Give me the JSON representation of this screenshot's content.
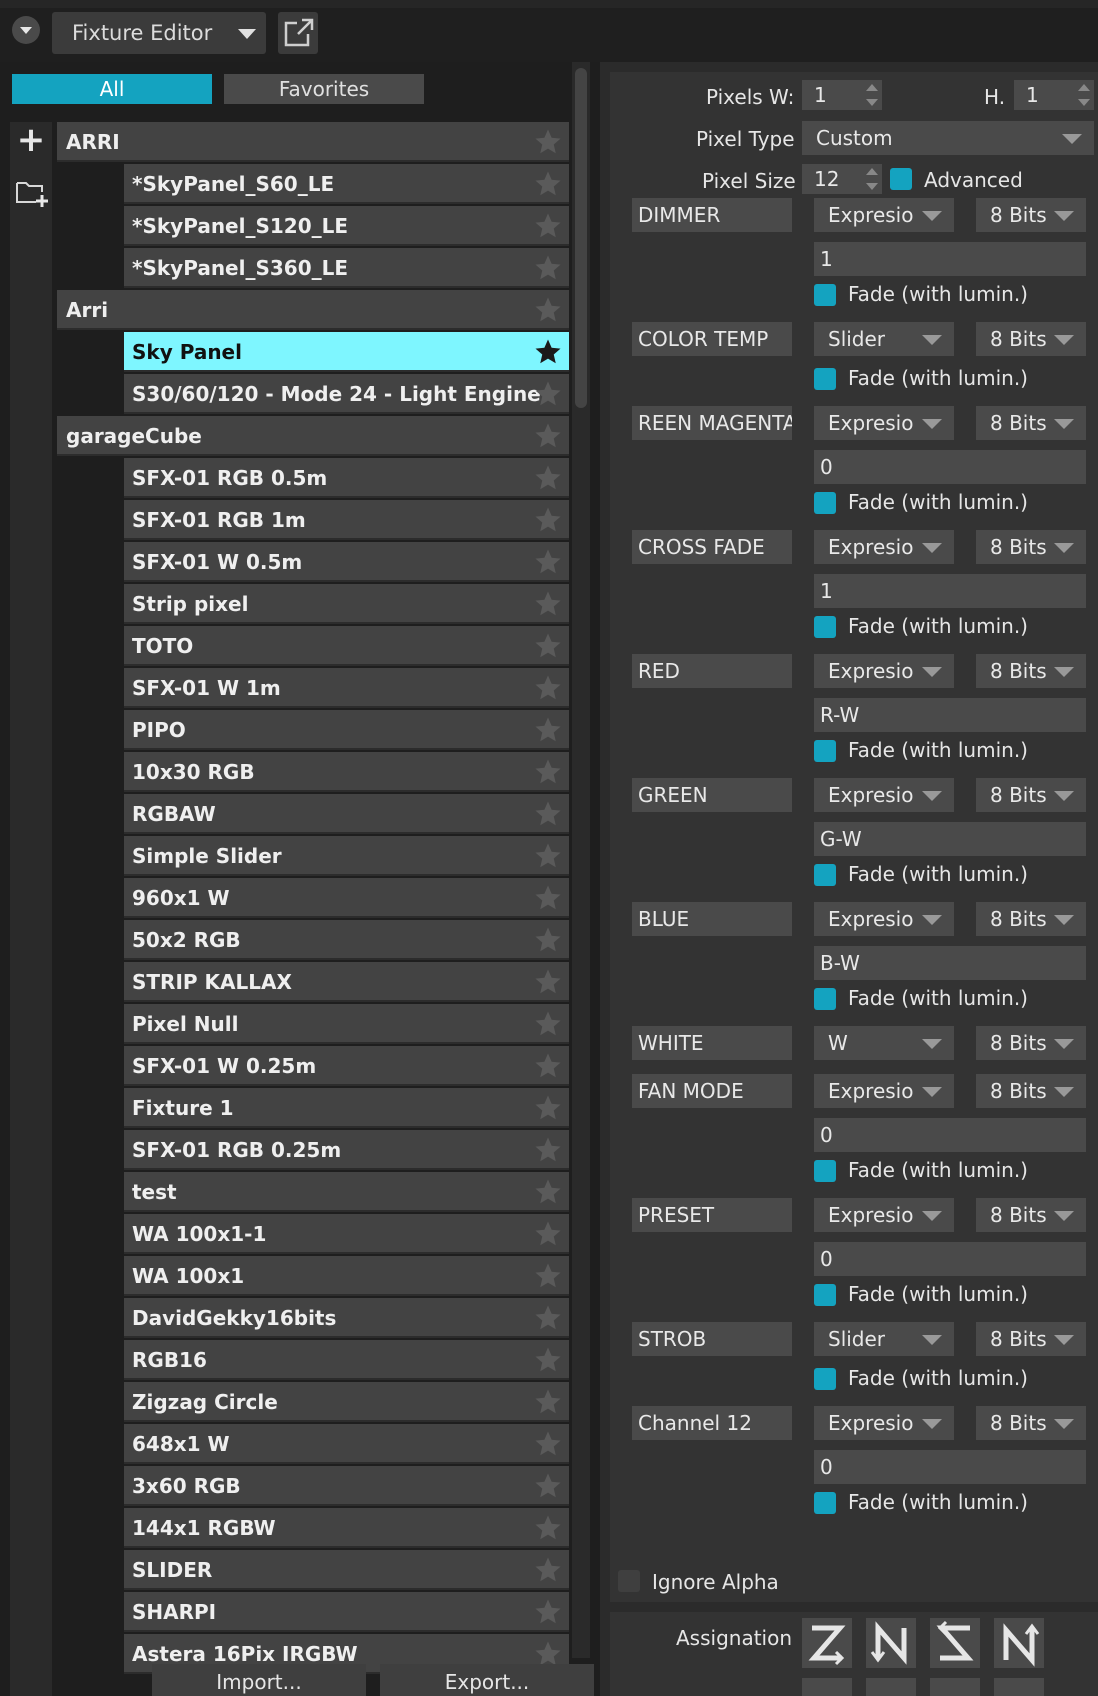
{
  "header": {
    "title": "Fixture Editor"
  },
  "tabs": {
    "all": "All",
    "favorites": "Favorites"
  },
  "fixtures": [
    {
      "label": "ARRI",
      "kind": "group",
      "favorite": false
    },
    {
      "label": "*SkyPanel_S60_LE",
      "kind": "item",
      "favorite": false
    },
    {
      "label": "*SkyPanel_S120_LE",
      "kind": "item",
      "favorite": false
    },
    {
      "label": "*SkyPanel_S360_LE",
      "kind": "item",
      "favorite": false
    },
    {
      "label": "Arri",
      "kind": "group",
      "favorite": false
    },
    {
      "label": "Sky Panel",
      "kind": "item",
      "selected": true,
      "favorite": true
    },
    {
      "label": "S30/60/120 - Mode 24 - Light Engine",
      "kind": "item",
      "favorite": false
    },
    {
      "label": "garageCube",
      "kind": "group",
      "favorite": false
    },
    {
      "label": "SFX-01 RGB 0.5m",
      "kind": "item",
      "favorite": false
    },
    {
      "label": "SFX-01 RGB 1m",
      "kind": "item",
      "favorite": false
    },
    {
      "label": "SFX-01 W 0.5m",
      "kind": "item",
      "favorite": false
    },
    {
      "label": "Strip pixel",
      "kind": "item",
      "favorite": false
    },
    {
      "label": "TOTO",
      "kind": "item",
      "favorite": false
    },
    {
      "label": "SFX-01 W 1m",
      "kind": "item",
      "favorite": false
    },
    {
      "label": "PIPO",
      "kind": "item",
      "favorite": false
    },
    {
      "label": "10x30 RGB",
      "kind": "item",
      "favorite": false
    },
    {
      "label": "RGBAW",
      "kind": "item",
      "favorite": false
    },
    {
      "label": "Simple Slider",
      "kind": "item",
      "favorite": false
    },
    {
      "label": "960x1 W",
      "kind": "item",
      "favorite": false
    },
    {
      "label": "50x2 RGB",
      "kind": "item",
      "favorite": false
    },
    {
      "label": "STRIP KALLAX",
      "kind": "item",
      "favorite": false
    },
    {
      "label": "Pixel Null",
      "kind": "item",
      "favorite": false
    },
    {
      "label": "SFX-01 W 0.25m",
      "kind": "item",
      "favorite": false
    },
    {
      "label": "Fixture 1",
      "kind": "item",
      "favorite": false
    },
    {
      "label": "SFX-01 RGB 0.25m",
      "kind": "item",
      "favorite": false
    },
    {
      "label": "test",
      "kind": "item",
      "favorite": false
    },
    {
      "label": "WA 100x1-1",
      "kind": "item",
      "favorite": false
    },
    {
      "label": "WA 100x1",
      "kind": "item",
      "favorite": false
    },
    {
      "label": "DavidGekky16bits",
      "kind": "item",
      "favorite": false
    },
    {
      "label": "RGB16",
      "kind": "item",
      "favorite": false
    },
    {
      "label": "Zigzag Circle",
      "kind": "item",
      "favorite": false
    },
    {
      "label": "648x1 W",
      "kind": "item",
      "favorite": false
    },
    {
      "label": "3x60 RGB",
      "kind": "item",
      "favorite": false
    },
    {
      "label": "144x1 RGBW",
      "kind": "item",
      "favorite": false
    },
    {
      "label": "SLIDER",
      "kind": "item",
      "favorite": false
    },
    {
      "label": "SHARPI",
      "kind": "item",
      "favorite": false
    },
    {
      "label": "Astera 16Pix IRGBW",
      "kind": "item",
      "favorite": false
    }
  ],
  "buttons": {
    "import": "Import...",
    "export": "Export..."
  },
  "pixels": {
    "w_label": "Pixels W:",
    "w_value": "1",
    "h_label": "H.",
    "h_value": "1",
    "type_label": "Pixel Type",
    "type_value": "Custom",
    "size_label": "Pixel Size",
    "size_value": "12",
    "advanced_label": "Advanced",
    "advanced_checked": true
  },
  "channels": [
    {
      "name": "DIMMER",
      "mode": "Expresio",
      "bits": "8 Bits",
      "expr": "1",
      "fade": "Fade (with lumin.)"
    },
    {
      "name": "COLOR TEMP",
      "mode": "Slider",
      "bits": "8 Bits",
      "expr": null,
      "fade": "Fade (with lumin.)"
    },
    {
      "name": "REEN MAGENTA",
      "mode": "Expresio",
      "bits": "8 Bits",
      "expr": "0",
      "fade": "Fade (with lumin.)"
    },
    {
      "name": "CROSS FADE",
      "mode": "Expresio",
      "bits": "8 Bits",
      "expr": "1",
      "fade": "Fade (with lumin.)"
    },
    {
      "name": "RED",
      "mode": "Expresio",
      "bits": "8 Bits",
      "expr": "R-W",
      "fade": "Fade (with lumin.)"
    },
    {
      "name": "GREEN",
      "mode": "Expresio",
      "bits": "8 Bits",
      "expr": "G-W",
      "fade": "Fade (with lumin.)"
    },
    {
      "name": "BLUE",
      "mode": "Expresio",
      "bits": "8 Bits",
      "expr": "B-W",
      "fade": "Fade (with lumin.)"
    },
    {
      "name": "WHITE",
      "mode": "W",
      "bits": "8 Bits",
      "expr": null,
      "fade": null
    },
    {
      "name": "FAN MODE",
      "mode": "Expresio",
      "bits": "8 Bits",
      "expr": "0",
      "fade": "Fade (with lumin.)"
    },
    {
      "name": "PRESET",
      "mode": "Expresio",
      "bits": "8 Bits",
      "expr": "0",
      "fade": "Fade (with lumin.)"
    },
    {
      "name": "STROB",
      "mode": "Slider",
      "bits": "8 Bits",
      "expr": null,
      "fade": "Fade (with lumin.)"
    },
    {
      "name": "Channel 12",
      "mode": "Expresio",
      "bits": "8 Bits",
      "expr": "0",
      "fade": "Fade (with lumin.)"
    }
  ],
  "ignore_alpha": {
    "label": "Ignore Alpha",
    "checked": false
  },
  "assignation": {
    "label": "Assignation",
    "buttons": [
      "zigzag-right-icon",
      "zigzag-down-icon",
      "zigzag-left-icon",
      "zigzag-up-icon"
    ]
  },
  "colors": {
    "accent": "#14a3c0",
    "selected_row": "#7ef6ff"
  }
}
